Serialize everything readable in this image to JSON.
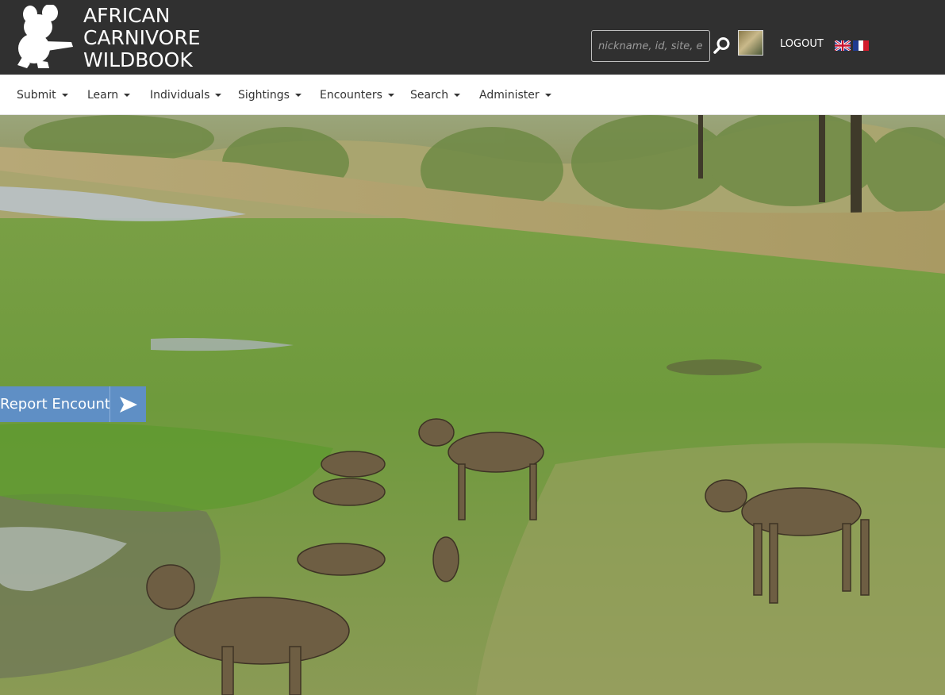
{
  "header": {
    "brand_line1": "AFRICAN",
    "brand_line2": "CARNIVORE",
    "brand_line3": "WILDBOOK",
    "search_placeholder": "nickname, id, site, encounter",
    "logout_label": "LOGOUT",
    "languages": [
      "English",
      "Français"
    ]
  },
  "nav": {
    "items": [
      {
        "label": "Submit"
      },
      {
        "label": "Learn"
      },
      {
        "label": "Individuals"
      },
      {
        "label": "Sightings"
      },
      {
        "label": "Encounters"
      },
      {
        "label": "Search"
      },
      {
        "label": "Administer"
      }
    ]
  },
  "hero": {
    "report_label": "Report Encounter"
  },
  "icons": {
    "logo": "wild-dog-silhouette-icon",
    "search": "search-icon",
    "report_arrow": "paper-plane-arrow-icon"
  },
  "colors": {
    "header_bg": "#303030",
    "nav_bg": "#ffffff",
    "report_button": "#5f8fc5"
  }
}
